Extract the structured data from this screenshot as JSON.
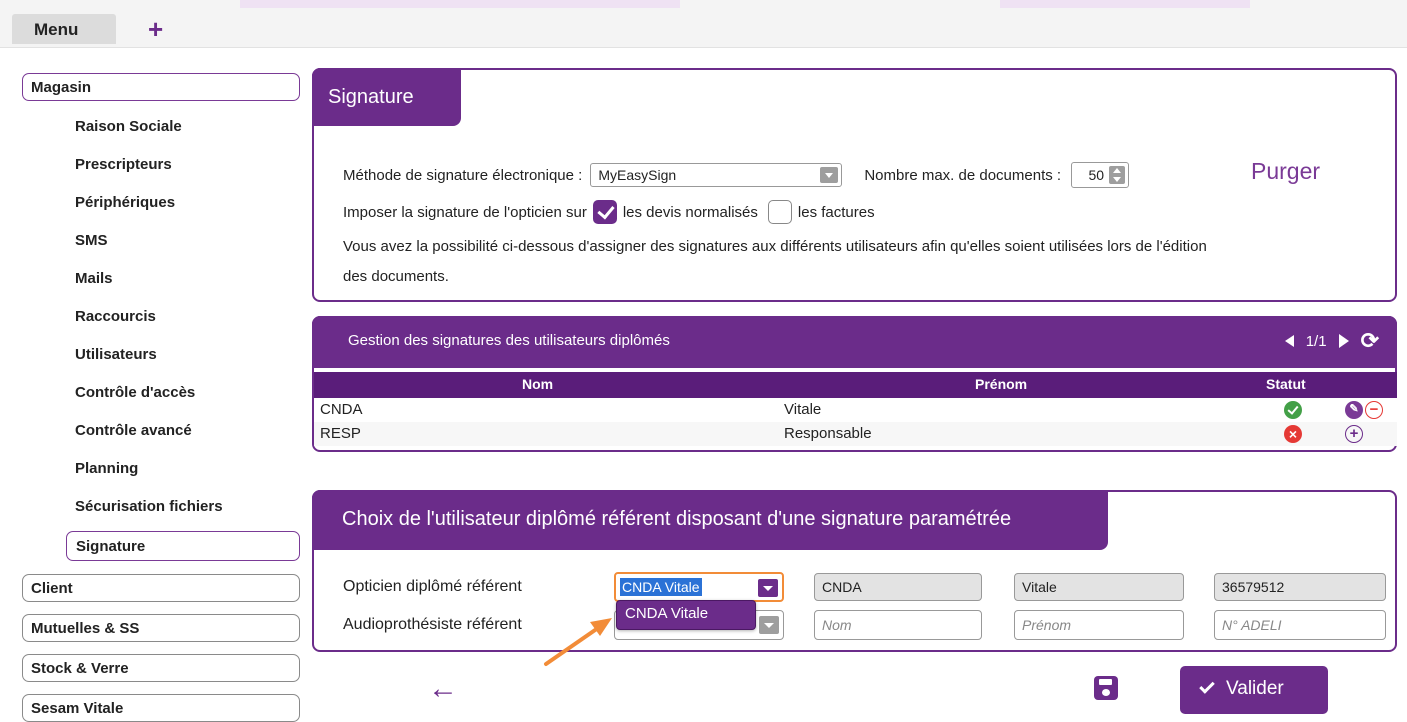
{
  "topbar": {
    "menu_label": "Menu",
    "plus_label": "+"
  },
  "sidebar": {
    "group_magasin": "Magasin",
    "items": [
      "Raison Sociale",
      "Prescripteurs",
      "Périphériques",
      "SMS",
      "Mails",
      "Raccourcis",
      "Utilisateurs",
      "Contrôle d'accès",
      "Contrôle avancé",
      "Planning",
      "Sécurisation fichiers",
      "Signature"
    ],
    "active_item": "Signature",
    "groups_other": [
      "Client",
      "Mutuelles & SS",
      "Stock & Verre",
      "Sesam Vitale"
    ]
  },
  "signature_panel": {
    "title": "Signature",
    "method_label": "Méthode de signature électronique :",
    "method_value": "MyEasySign",
    "max_docs_label": "Nombre max. de documents :",
    "max_docs_value": "50",
    "purge_label": "Purger",
    "impose_label": "Imposer la signature de l'opticien sur",
    "devis_label": "les devis normalisés",
    "devis_checked": true,
    "factures_label": "les factures",
    "factures_checked": false,
    "info_line1": "Vous avez la possibilité ci-dessous d'assigner des signatures aux différents utilisateurs afin qu'elles soient utilisées lors de l'édition",
    "info_line2": "des documents."
  },
  "users_table": {
    "title": "Gestion des signatures des utilisateurs diplômés",
    "page": "1/1",
    "columns": [
      "Nom",
      "Prénom",
      "Statut"
    ],
    "rows": [
      {
        "nom": "CNDA",
        "prenom": "Vitale",
        "statut": "ok"
      },
      {
        "nom": "RESP",
        "prenom": "Responsable",
        "statut": "ko"
      }
    ]
  },
  "referent_panel": {
    "title": "Choix de l'utilisateur diplômé référent disposant d'une signature paramétrée",
    "opticien_label": "Opticien diplômé référent",
    "opticien_select": "CNDA Vitale",
    "opticien_nom": "CNDA",
    "opticien_prenom": "Vitale",
    "opticien_adeli": "36579512",
    "audio_label": "Audioprothésiste référent",
    "audio_nom_placeholder": "Nom",
    "audio_prenom_placeholder": "Prénom",
    "audio_adeli_placeholder": "N° ADELI",
    "dropdown_option": "CNDA Vitale"
  },
  "actions": {
    "validate_label": "Valider",
    "back_icon": "arrow-left-icon",
    "save_icon": "floppy-disk-icon"
  },
  "colors": {
    "brand_purple": "#6b2c8a",
    "dark_purple": "#5a1d7a",
    "annotation_orange": "#f28c38",
    "ok_green": "#43a047",
    "ko_red": "#e53935"
  }
}
